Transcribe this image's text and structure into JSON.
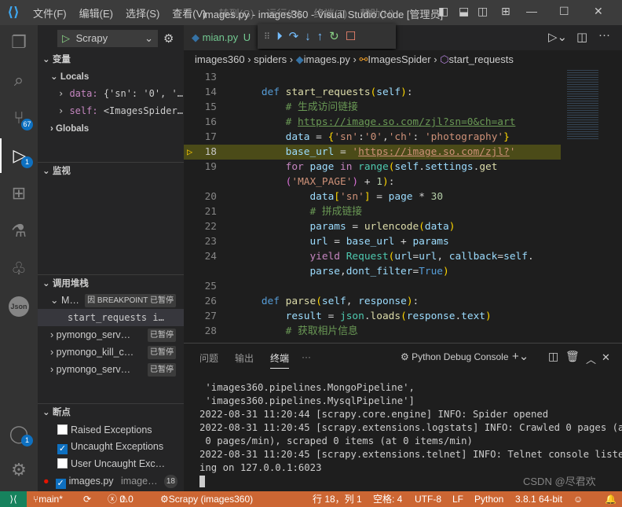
{
  "titlebar": {
    "menus": [
      "文件(F)",
      "编辑(E)",
      "选择(S)",
      "查看(V)",
      "转到(G)",
      "运行(R)",
      "终端(T)",
      "帮助(H)"
    ],
    "title": "images.py - images360 - Visual Studio Code [管理员]"
  },
  "activity": {
    "scm_badge": "67",
    "debug_badge": "1",
    "account_badge": "1",
    "json_label": "Json"
  },
  "sidebar": {
    "config": "Scrapy",
    "variables_header": "变量",
    "locals": "Locals",
    "vars": [
      {
        "name": "data:",
        "value": "{'sn': '0', '…"
      },
      {
        "name": "self:",
        "value": "<ImagesSpider…"
      }
    ],
    "globals": "Globals",
    "watch_header": "监视",
    "callstack_header": "调用堆栈",
    "threads": [
      {
        "name": "M…",
        "status": "因 BREAKPOINT 已暂停"
      },
      {
        "name": "pymongo_serv…",
        "status": "已暂停"
      },
      {
        "name": "pymongo_kill_c…",
        "status": "已暂停"
      },
      {
        "name": "pymongo_serv…",
        "status": "已暂停"
      }
    ],
    "frame": {
      "name": "start_requests",
      "file": "i…"
    },
    "breakpoints_header": "断点",
    "breakpoints": [
      {
        "label": "Raised Exceptions",
        "checked": false
      },
      {
        "label": "Uncaught Exceptions",
        "checked": true
      },
      {
        "label": "User Uncaught Exc…",
        "checked": false
      }
    ],
    "bp_file": {
      "name": "images.py",
      "path": "image…",
      "line": "18"
    }
  },
  "tab": {
    "name": "mian.py",
    "status": "U"
  },
  "breadcrumb": [
    "images360",
    "spiders",
    "images.py",
    "ImagesSpider",
    "start_requests"
  ],
  "code": [
    {
      "n": "13",
      "t": []
    },
    {
      "n": "14",
      "t": [
        [
          "    ",
          "w"
        ],
        [
          "def",
          "k"
        ],
        [
          " ",
          "w"
        ],
        [
          "start_requests",
          "f"
        ],
        [
          "(",
          "y"
        ],
        [
          "self",
          "v"
        ],
        [
          ")",
          "y"
        ],
        [
          ":",
          "w"
        ]
      ]
    },
    {
      "n": "15",
      "t": [
        [
          "        # 生成访问链接",
          "m"
        ]
      ]
    },
    {
      "n": "16",
      "t": [
        [
          "        # ",
          "m"
        ],
        [
          "https://image.so.com/zjl?sn=0&ch=art",
          "m u"
        ]
      ]
    },
    {
      "n": "17",
      "t": [
        [
          "        ",
          "w"
        ],
        [
          "data",
          "v"
        ],
        [
          " = ",
          "w"
        ],
        [
          "{",
          "y"
        ],
        [
          "'sn'",
          "s"
        ],
        [
          ":",
          "w"
        ],
        [
          "'0'",
          "s"
        ],
        [
          ",",
          "w"
        ],
        [
          "'ch'",
          "s"
        ],
        [
          ": ",
          "w"
        ],
        [
          "'photography'",
          "s"
        ],
        [
          "}",
          "y"
        ]
      ]
    },
    {
      "n": "18",
      "t": [
        [
          "        ",
          "w"
        ],
        [
          "base_url",
          "v"
        ],
        [
          " = ",
          "w"
        ],
        [
          "'",
          "s"
        ],
        [
          "https://image.so.com/zjl?",
          "s u"
        ],
        [
          "'",
          "s"
        ]
      ],
      "hl": true
    },
    {
      "n": "19",
      "t": [
        [
          "        ",
          "w"
        ],
        [
          "for",
          "c"
        ],
        [
          " ",
          "w"
        ],
        [
          "page",
          "v"
        ],
        [
          " ",
          "w"
        ],
        [
          "in",
          "c"
        ],
        [
          " ",
          "w"
        ],
        [
          "range",
          "t"
        ],
        [
          "(",
          "y"
        ],
        [
          "self",
          "v"
        ],
        [
          ".",
          "w"
        ],
        [
          "settings",
          "v"
        ],
        [
          ".",
          "w"
        ],
        [
          "get",
          "f"
        ]
      ]
    },
    {
      "n": "",
      "t": [
        [
          "        ",
          "w"
        ],
        [
          "(",
          "p"
        ],
        [
          "'MAX_PAGE'",
          "s"
        ],
        [
          ")",
          "p"
        ],
        [
          " + ",
          "w"
        ],
        [
          "1",
          "n"
        ],
        [
          ")",
          "y"
        ],
        [
          ":",
          "w"
        ]
      ]
    },
    {
      "n": "20",
      "t": [
        [
          "            ",
          "w"
        ],
        [
          "data",
          "v"
        ],
        [
          "[",
          "y"
        ],
        [
          "'sn'",
          "s"
        ],
        [
          "]",
          "y"
        ],
        [
          " = ",
          "w"
        ],
        [
          "page",
          "v"
        ],
        [
          " * ",
          "w"
        ],
        [
          "30",
          "n"
        ]
      ]
    },
    {
      "n": "21",
      "t": [
        [
          "            # 拼成链接",
          "m"
        ]
      ]
    },
    {
      "n": "22",
      "t": [
        [
          "            ",
          "w"
        ],
        [
          "params",
          "v"
        ],
        [
          " = ",
          "w"
        ],
        [
          "urlencode",
          "f"
        ],
        [
          "(",
          "y"
        ],
        [
          "data",
          "v"
        ],
        [
          ")",
          "y"
        ]
      ]
    },
    {
      "n": "23",
      "t": [
        [
          "            ",
          "w"
        ],
        [
          "url",
          "v"
        ],
        [
          " = ",
          "w"
        ],
        [
          "base_url",
          "v"
        ],
        [
          " + ",
          "w"
        ],
        [
          "params",
          "v"
        ]
      ]
    },
    {
      "n": "24",
      "t": [
        [
          "            ",
          "w"
        ],
        [
          "yield",
          "c"
        ],
        [
          " ",
          "w"
        ],
        [
          "Request",
          "t"
        ],
        [
          "(",
          "y"
        ],
        [
          "url",
          "v"
        ],
        [
          "=",
          "w"
        ],
        [
          "url",
          "v"
        ],
        [
          ", ",
          "w"
        ],
        [
          "callback",
          "v"
        ],
        [
          "=",
          "w"
        ],
        [
          "self",
          "v"
        ],
        [
          ".",
          "w"
        ]
      ]
    },
    {
      "n": "",
      "t": [
        [
          "            ",
          "w"
        ],
        [
          "parse",
          "v"
        ],
        [
          ",",
          "w"
        ],
        [
          "dont_filter",
          "v"
        ],
        [
          "=",
          "w"
        ],
        [
          "True",
          "k"
        ],
        [
          ")",
          "y"
        ]
      ]
    },
    {
      "n": "25",
      "t": []
    },
    {
      "n": "26",
      "t": [
        [
          "    ",
          "w"
        ],
        [
          "def",
          "k"
        ],
        [
          " ",
          "w"
        ],
        [
          "parse",
          "f"
        ],
        [
          "(",
          "y"
        ],
        [
          "self",
          "v"
        ],
        [
          ", ",
          "w"
        ],
        [
          "response",
          "v"
        ],
        [
          ")",
          "y"
        ],
        [
          ":",
          "w"
        ]
      ]
    },
    {
      "n": "27",
      "t": [
        [
          "        ",
          "w"
        ],
        [
          "result",
          "v"
        ],
        [
          " = ",
          "w"
        ],
        [
          "json",
          "t"
        ],
        [
          ".",
          "w"
        ],
        [
          "loads",
          "f"
        ],
        [
          "(",
          "y"
        ],
        [
          "response",
          "v"
        ],
        [
          ".",
          "w"
        ],
        [
          "text",
          "v"
        ],
        [
          ")",
          "y"
        ]
      ]
    },
    {
      "n": "28",
      "t": [
        [
          "        # 获取相片信息",
          "m"
        ]
      ]
    }
  ],
  "panel": {
    "tabs": [
      "问题",
      "输出",
      "终端",
      "···"
    ],
    "active_tab": "终端",
    "terminal_name": "Python Debug Console",
    "lines": [
      " 'images360.pipelines.MongoPipeline',",
      " 'images360.pipelines.MysqlPipeline']",
      "2022-08-31 11:20:44 [scrapy.core.engine] INFO: Spider opened",
      "2022-08-31 11:20:45 [scrapy.extensions.logstats] INFO: Crawled 0 pages (at",
      " 0 pages/min), scraped 0 items (at 0 items/min)",
      "2022-08-31 11:20:45 [scrapy.extensions.telnet] INFO: Telnet console listen",
      "ing on 127.0.0.1:6023"
    ]
  },
  "statusbar": {
    "branch": "main*",
    "errors": "0",
    "warnings": "0",
    "debug": "Scrapy (images360)",
    "position": "行 18，列 1",
    "spaces": "空格: 4",
    "encoding": "UTF-8",
    "eol": "LF",
    "language": "Python",
    "interpreter": "3.8.1 64-bit",
    "watermark": "CSDN @尽君欢"
  },
  "colors": {
    "statusbar": "#cc6633",
    "remote": "#16825d",
    "accent": "#0e70c0",
    "highlight": "#4b4b18"
  }
}
